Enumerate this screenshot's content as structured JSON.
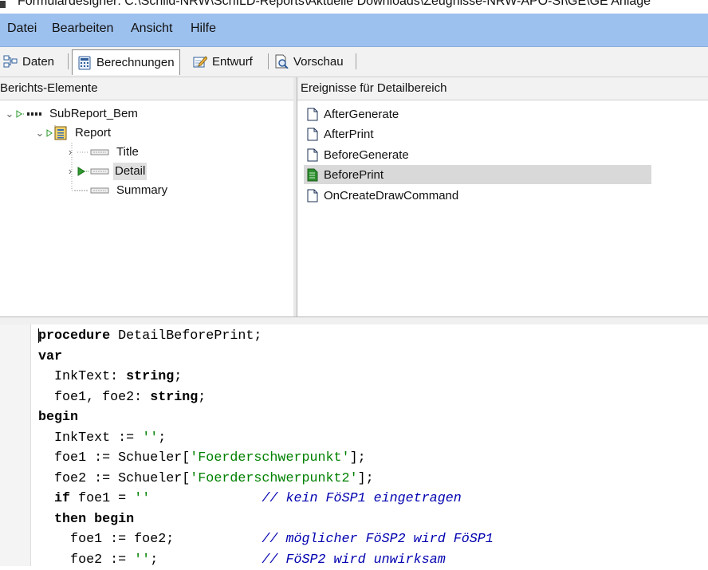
{
  "window": {
    "title": "Formulardesigner: C:\\Schild-NRW\\SchILD-Reports\\Aktuelle Downloads\\Zeugnisse-NRW-APO-SI\\GE\\GE Anlage"
  },
  "menu": {
    "items": [
      "Datei",
      "Bearbeiten",
      "Ansicht",
      "Hilfe"
    ]
  },
  "tabs": [
    {
      "label": "Daten",
      "icon": "data-tree-icon"
    },
    {
      "label": "Berechnungen",
      "icon": "calculator-icon"
    },
    {
      "label": "Entwurf",
      "icon": "design-pencil-icon"
    },
    {
      "label": "Vorschau",
      "icon": "preview-magnifier-icon"
    }
  ],
  "left_panel": {
    "header": "Berichts-Elemente",
    "tree": [
      {
        "label": "SubReport_Bem"
      },
      {
        "label": "Report"
      },
      {
        "label": "Title"
      },
      {
        "label": "Detail",
        "selected": true
      },
      {
        "label": "Summary"
      }
    ]
  },
  "right_panel": {
    "header": "Ereignisse für Detailbereich",
    "events": [
      {
        "label": "AfterGenerate"
      },
      {
        "label": "AfterPrint"
      },
      {
        "label": "BeforeGenerate"
      },
      {
        "label": "BeforePrint",
        "selected": true
      },
      {
        "label": "OnCreateDrawCommand"
      }
    ]
  },
  "editor": {
    "lines": [
      [
        {
          "t": "procedure",
          "c": "kw"
        },
        {
          "t": " DetailBeforePrint;"
        }
      ],
      [
        {
          "t": "var",
          "c": "kw"
        }
      ],
      [
        {
          "t": "  InkText: "
        },
        {
          "t": "string",
          "c": "kw"
        },
        {
          "t": ";"
        }
      ],
      [
        {
          "t": "  foe1, foe2: "
        },
        {
          "t": "string",
          "c": "kw"
        },
        {
          "t": ";"
        }
      ],
      [
        {
          "t": "begin",
          "c": "kw"
        }
      ],
      [
        {
          "t": "  InkText := "
        },
        {
          "t": "''",
          "c": "str"
        },
        {
          "t": ";"
        }
      ],
      [
        {
          "t": "  foe1 := Schueler["
        },
        {
          "t": "'Foerderschwerpunkt'",
          "c": "str"
        },
        {
          "t": "];"
        }
      ],
      [
        {
          "t": "  foe2 := Schueler["
        },
        {
          "t": "'Foerderschwerpunkt2'",
          "c": "str"
        },
        {
          "t": "];"
        }
      ],
      [
        {
          "t": "  "
        },
        {
          "t": "if",
          "c": "kw"
        },
        {
          "t": " foe1 = "
        },
        {
          "t": "''",
          "c": "str"
        },
        {
          "t": "              "
        },
        {
          "t": "// kein FöSP1 eingetragen",
          "c": "cmt"
        }
      ],
      [
        {
          "t": "  "
        },
        {
          "t": "then begin",
          "c": "kw"
        }
      ],
      [
        {
          "t": "    foe1 := foe2;           "
        },
        {
          "t": "// möglicher FöSP2 wird FöSP1",
          "c": "cmt"
        }
      ],
      [
        {
          "t": "    foe2 := "
        },
        {
          "t": "''",
          "c": "str"
        },
        {
          "t": ";             "
        },
        {
          "t": "// FöSP2 wird unwirksam",
          "c": "cmt"
        }
      ]
    ]
  }
}
